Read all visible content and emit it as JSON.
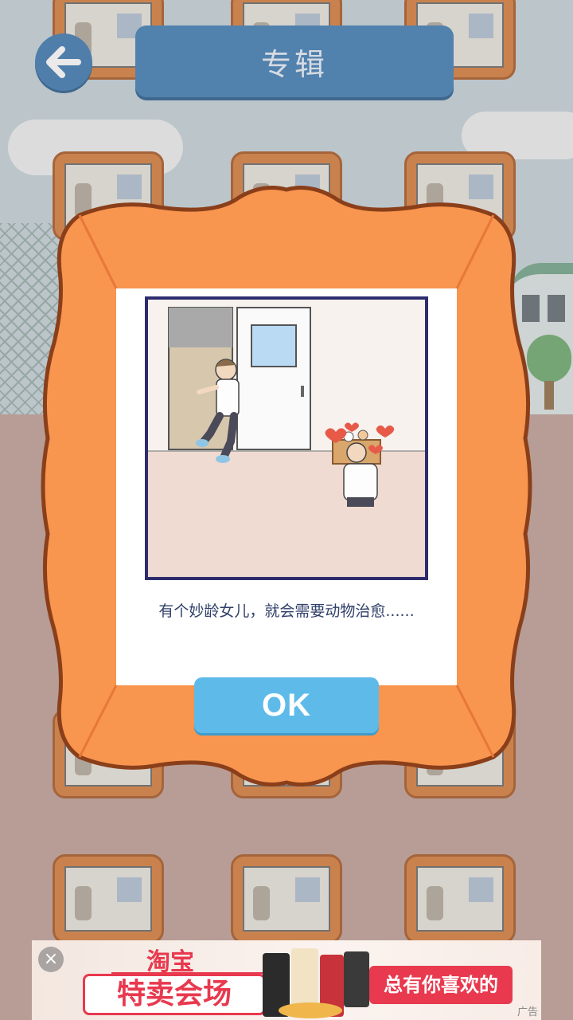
{
  "header": {
    "title": "专辑",
    "back_icon": "back-arrow-icon"
  },
  "dialog": {
    "caption": "有个妙龄女儿，就会需要动物治愈......",
    "ok_label": "OK"
  },
  "ad": {
    "brand": "淘宝",
    "headline": "特卖会场",
    "slogan": "总有你喜欢的",
    "tag": "广告",
    "close_symbol": "×"
  },
  "colors": {
    "frame_orange": "#f8954f",
    "frame_border": "#8a3f1a",
    "title_blue": "#5089bb",
    "ok_blue": "#5ebbe9",
    "ad_red": "#e8394e"
  }
}
